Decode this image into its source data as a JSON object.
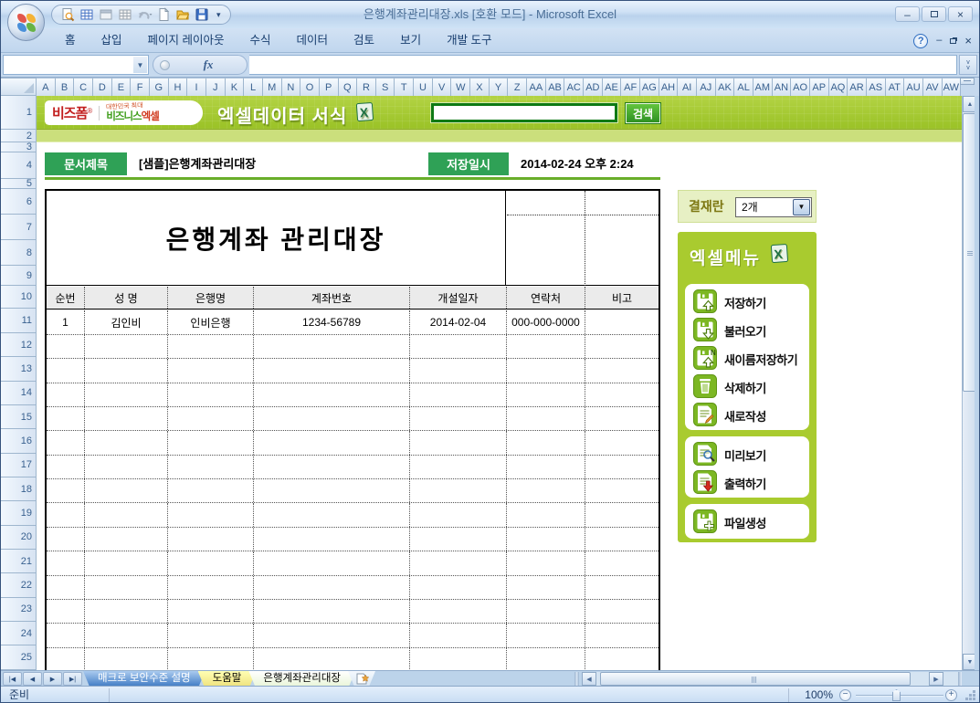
{
  "window": {
    "title": "은행계좌관리대장.xls  [호환 모드]  -  Microsoft Excel",
    "controls": [
      "minimize",
      "maximize",
      "close"
    ],
    "workbook_controls": [
      "help",
      "minimize",
      "restore",
      "close"
    ]
  },
  "qat": {
    "icons": [
      "print-preview-icon",
      "table-icon",
      "window-icon",
      "grid-icon",
      "undo-icon",
      "new-document-icon",
      "open-folder-icon",
      "save-icon"
    ]
  },
  "ribbon": {
    "tabs": [
      "홈",
      "삽입",
      "페이지 레이아웃",
      "수식",
      "데이터",
      "검토",
      "보기",
      "개발 도구"
    ]
  },
  "formula_bar": {
    "fx_label": "fx"
  },
  "grid": {
    "column_letters": [
      "A",
      "B",
      "C",
      "D",
      "E",
      "F",
      "G",
      "H",
      "I",
      "J",
      "K",
      "L",
      "M",
      "N",
      "O",
      "P",
      "Q",
      "R",
      "S",
      "T",
      "U",
      "V",
      "W",
      "X",
      "Y",
      "Z",
      "AA",
      "AB",
      "AC",
      "AD",
      "AE",
      "AF",
      "AG",
      "AH",
      "AI",
      "AJ",
      "AK",
      "AL",
      "AM",
      "AN",
      "AO",
      "AP",
      "AQ",
      "AR",
      "AS",
      "AT",
      "AU",
      "AV",
      "AW"
    ],
    "row_numbers": [
      "1",
      "2",
      "3",
      "4",
      "5",
      "6",
      "7",
      "8",
      "9",
      "10",
      "11",
      "12",
      "13",
      "14",
      "15",
      "16",
      "17",
      "18",
      "19",
      "20",
      "21",
      "22",
      "23",
      "24",
      "25"
    ]
  },
  "banner": {
    "logo_main": "비즈폼",
    "logo_reg": "®",
    "logo_tagline": "대한민국 최대",
    "logo_sub_green": "비즈니스",
    "logo_sub_red": "엑셀",
    "title": "엑셀데이터 서식",
    "search_value": "",
    "search_button": "검색",
    "colors": {
      "banner_green": "#9ac226",
      "search_border": "#0e7a14",
      "button_green": "#2e9122"
    }
  },
  "doc_header": {
    "label_title": "문서제목",
    "title_value": "[샘플]은행계좌관리대장",
    "label_saved": "저장일시",
    "saved_value": "2014-02-24  오후 2:24",
    "badge_color": "#2fa156"
  },
  "sheet_table": {
    "title": "은행계좌 관리대장",
    "columns": [
      "순번",
      "성  명",
      "은행명",
      "계좌번호",
      "개설일자",
      "연락처",
      "비고"
    ],
    "rows": [
      [
        "1",
        "김인비",
        "인비은행",
        "1234-56789",
        "2014-02-04",
        "000-000-0000",
        ""
      ]
    ],
    "empty_row_count": 14
  },
  "approval": {
    "label": "결재란",
    "count_value": "2개"
  },
  "excel_menu": {
    "title": "엑셀메뉴",
    "title_icon": "excel-icon",
    "panel_color": "#a9cb2f",
    "groups": [
      [
        {
          "icon": "save-up-icon",
          "label": "저장하기"
        },
        {
          "icon": "load-icon",
          "label": "불러오기"
        },
        {
          "icon": "save-as-icon",
          "label": "새이름저장하기"
        },
        {
          "icon": "trash-icon",
          "label": "삭제하기"
        },
        {
          "icon": "new-doc-icon",
          "label": "새로작성"
        }
      ],
      [
        {
          "icon": "preview-icon",
          "label": "미리보기"
        },
        {
          "icon": "print-icon",
          "label": "출력하기"
        }
      ],
      [
        {
          "icon": "file-create-icon",
          "label": "파일생성"
        }
      ]
    ]
  },
  "sheet_tabs": {
    "nav": [
      "first",
      "prev",
      "next",
      "last"
    ],
    "tabs": [
      {
        "label": "매크로 보안수준 설명",
        "color": "blue"
      },
      {
        "label": "도움말",
        "color": "yellow"
      },
      {
        "label": "은행계좌관리대장",
        "color": "active"
      }
    ],
    "insert_icon": "insert-sheet-icon"
  },
  "status_bar": {
    "ready": "준비",
    "zoom": "100%"
  }
}
